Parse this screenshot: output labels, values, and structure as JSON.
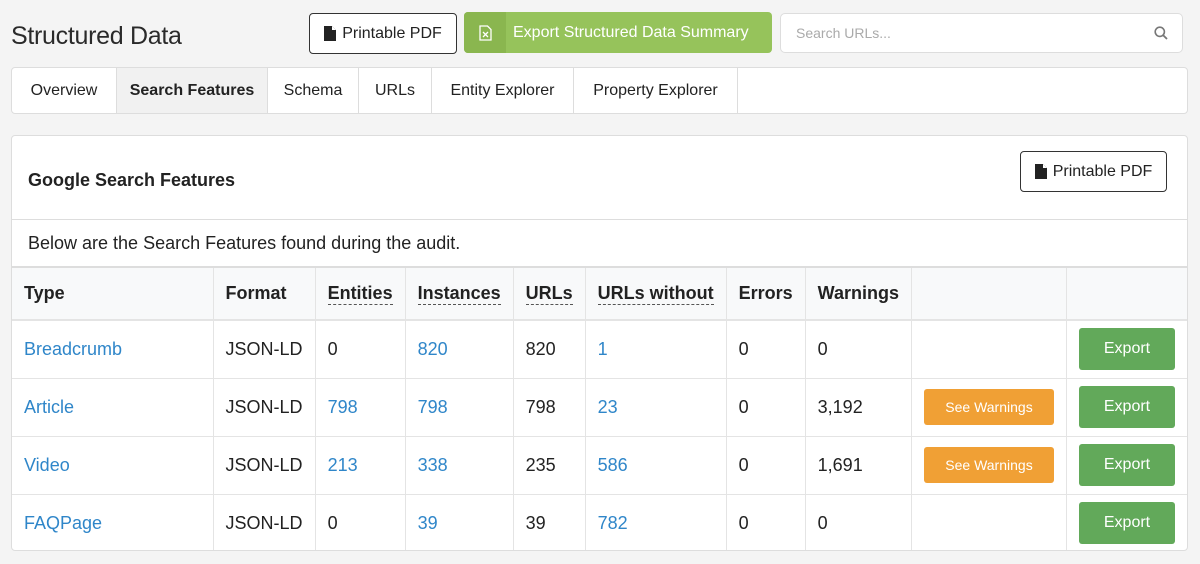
{
  "header": {
    "title": "Structured Data",
    "printable_pdf_label": "Printable PDF",
    "export_summary_label": "Export Structured Data Summary",
    "search_placeholder": "Search URLs...",
    "search_value": ""
  },
  "tabs": [
    {
      "label": "Overview",
      "active": false
    },
    {
      "label": "Search Features",
      "active": true
    },
    {
      "label": "Schema",
      "active": false
    },
    {
      "label": "URLs",
      "active": false
    },
    {
      "label": "Entity Explorer",
      "active": false
    },
    {
      "label": "Property Explorer",
      "active": false
    }
  ],
  "panel": {
    "title": "Google Search Features",
    "printable_pdf_label": "Printable PDF",
    "description": "Below are the Search Features found during the audit."
  },
  "table": {
    "columns": [
      "Type",
      "Format",
      "Entities",
      "Instances",
      "URLs",
      "URLs without",
      "Errors",
      "Warnings",
      "",
      ""
    ],
    "rows": [
      {
        "type": "Breadcrumb",
        "format": "JSON-LD",
        "entities": "0",
        "instances": "820",
        "urls": "820",
        "urls_without": "1",
        "errors": "0",
        "warnings": "0",
        "see_warnings": "",
        "export": "Export"
      },
      {
        "type": "Article",
        "format": "JSON-LD",
        "entities": "798",
        "instances": "798",
        "urls": "798",
        "urls_without": "23",
        "errors": "0",
        "warnings": "3,192",
        "see_warnings": "See Warnings",
        "export": "Export"
      },
      {
        "type": "Video",
        "format": "JSON-LD",
        "entities": "213",
        "instances": "338",
        "urls": "235",
        "urls_without": "586",
        "errors": "0",
        "warnings": "1,691",
        "see_warnings": "See Warnings",
        "export": "Export"
      },
      {
        "type": "FAQPage",
        "format": "JSON-LD",
        "entities": "0",
        "instances": "39",
        "urls": "39",
        "urls_without": "782",
        "errors": "0",
        "warnings": "0",
        "see_warnings": "",
        "export": "Export"
      }
    ]
  },
  "colors": {
    "link": "#2f86c9",
    "export_green": "#62a95a",
    "summary_green": "#96c35b",
    "warning_orange": "#f0a035"
  }
}
